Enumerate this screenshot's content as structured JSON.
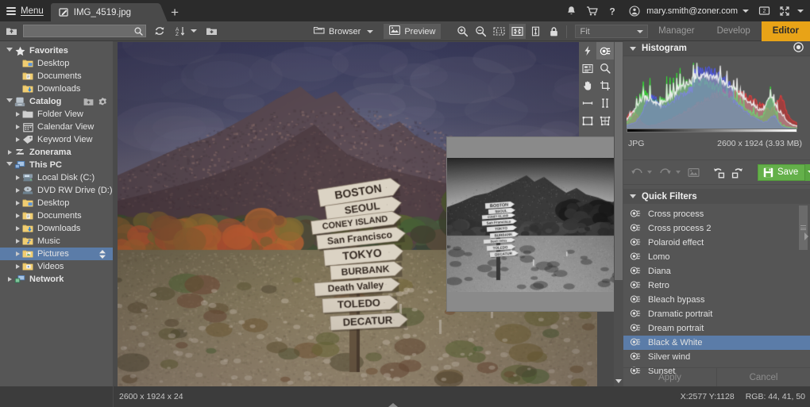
{
  "titlebar": {
    "menu_label": "Menu",
    "tab_title": "IMG_4519.jpg",
    "new_tab_label": "+",
    "account_email": "mary.smith@zoner.com",
    "icons": [
      "bell-icon",
      "cart-icon",
      "help-icon",
      "user-icon",
      "screen-icon",
      "fullscreen-icon"
    ]
  },
  "toolbar": {
    "search_value": "",
    "search_placeholder": "",
    "browser_label": "Browser",
    "preview_label": "Preview",
    "zoom_value": "Fit",
    "modes": [
      {
        "label": "Manager",
        "selected": false
      },
      {
        "label": "Develop",
        "selected": false
      },
      {
        "label": "Editor",
        "selected": true
      }
    ]
  },
  "sidebar": {
    "import_label": "Import",
    "items": [
      {
        "label": "Favorites",
        "level": 0,
        "icon": "star-icon",
        "arrow": "open",
        "group": true,
        "selected": false
      },
      {
        "label": "Desktop",
        "level": 1,
        "icon": "folder-desktop-icon",
        "arrow": "none",
        "group": false,
        "selected": false
      },
      {
        "label": "Documents",
        "level": 1,
        "icon": "folder-doc-icon",
        "arrow": "none",
        "group": false,
        "selected": false
      },
      {
        "label": "Downloads",
        "level": 1,
        "icon": "folder-dl-icon",
        "arrow": "none",
        "group": false,
        "selected": false
      },
      {
        "label": "Catalog",
        "level": 0,
        "icon": "catalog-icon",
        "arrow": "open",
        "group": true,
        "selected": false,
        "actions": [
          "add-folder-icon",
          "gear-icon"
        ]
      },
      {
        "label": "Folder View",
        "level": 1,
        "icon": "folder-icon",
        "arrow": "closed",
        "group": false,
        "selected": false
      },
      {
        "label": "Calendar View",
        "level": 1,
        "icon": "calendar-icon",
        "arrow": "closed",
        "group": false,
        "selected": false
      },
      {
        "label": "Keyword View",
        "level": 1,
        "icon": "tag-icon",
        "arrow": "closed",
        "group": false,
        "selected": false
      },
      {
        "label": "Zonerama",
        "level": 0,
        "icon": "zonerama-icon",
        "arrow": "closed",
        "group": true,
        "selected": false
      },
      {
        "label": "This PC",
        "level": 0,
        "icon": "pc-icon",
        "arrow": "open",
        "group": true,
        "selected": false
      },
      {
        "label": "Local Disk (C:)",
        "level": 1,
        "icon": "disk-icon",
        "arrow": "closed",
        "group": false,
        "selected": false
      },
      {
        "label": "DVD RW Drive (D:)",
        "level": 1,
        "icon": "dvd-icon",
        "arrow": "closed",
        "group": false,
        "selected": false
      },
      {
        "label": "Desktop",
        "level": 1,
        "icon": "folder-desktop-icon",
        "arrow": "closed",
        "group": false,
        "selected": false
      },
      {
        "label": "Documents",
        "level": 1,
        "icon": "folder-doc-icon",
        "arrow": "closed",
        "group": false,
        "selected": false
      },
      {
        "label": "Downloads",
        "level": 1,
        "icon": "folder-dl-icon",
        "arrow": "closed",
        "group": false,
        "selected": false
      },
      {
        "label": "Music",
        "level": 1,
        "icon": "folder-music-icon",
        "arrow": "closed",
        "group": false,
        "selected": false
      },
      {
        "label": "Pictures",
        "level": 1,
        "icon": "folder-pic-icon",
        "arrow": "closed",
        "group": false,
        "selected": true,
        "actions": [
          "updown-icon"
        ]
      },
      {
        "label": "Videos",
        "level": 1,
        "icon": "folder-video-icon",
        "arrow": "closed",
        "group": false,
        "selected": false
      },
      {
        "label": "Network",
        "level": 0,
        "icon": "network-icon",
        "arrow": "closed",
        "group": true,
        "selected": false
      }
    ]
  },
  "tools": [
    {
      "name": "effects-bolt-icon",
      "active": false
    },
    {
      "name": "filter-lens-icon",
      "active": true
    },
    {
      "name": "frame-icon",
      "active": false
    },
    {
      "name": "zoom-tool-icon",
      "active": false
    },
    {
      "name": "hand-tool-icon",
      "active": false
    },
    {
      "name": "crop-tool-icon",
      "active": false
    },
    {
      "name": "line-tool-icon",
      "active": false
    },
    {
      "name": "distance-tool-icon",
      "active": false
    },
    {
      "name": "rectangle-tool-icon",
      "active": false
    },
    {
      "name": "transform-tool-icon",
      "active": false
    },
    {
      "name": "gradient-tool-icon",
      "active": false
    },
    {
      "name": "redeye-tool-icon",
      "active": false
    }
  ],
  "histogram": {
    "title": "Histogram",
    "format": "JPG",
    "dimensions": "2600 x 1924 (3.93 MB)",
    "target_icon": "target-icon"
  },
  "actions": {
    "undo_icon": "undo-icon",
    "redo_icon": "redo-icon",
    "compare_icon": "compare-icon",
    "rotate_left_icon": "rotate-left-icon",
    "rotate_right_icon": "rotate-right-icon",
    "save_label": "Save",
    "share_icon": "share-icon"
  },
  "quick_filters": {
    "title": "Quick Filters",
    "apply_label": "Apply",
    "cancel_label": "Cancel",
    "items": [
      {
        "label": "Cross process",
        "selected": false
      },
      {
        "label": "Cross process 2",
        "selected": false
      },
      {
        "label": "Polaroid effect",
        "selected": false
      },
      {
        "label": "Lomo",
        "selected": false
      },
      {
        "label": "Diana",
        "selected": false
      },
      {
        "label": "Retro",
        "selected": false
      },
      {
        "label": "Bleach bypass",
        "selected": false
      },
      {
        "label": "Dramatic portrait",
        "selected": false
      },
      {
        "label": "Dream portrait",
        "selected": false
      },
      {
        "label": "Black & White",
        "selected": true
      },
      {
        "label": "Silver wind",
        "selected": false
      },
      {
        "label": "Sunset",
        "selected": false
      }
    ]
  },
  "status": {
    "image_info": "2600 x 1924 x 24",
    "coords": "X:2577 Y:1128",
    "rgb": "RGB: 44, 41, 50"
  },
  "colors": {
    "accent": "#e8a317",
    "selection": "#5b7ca8",
    "save_green": "#64b04a",
    "titlebar": "#2b2b2b",
    "toolbar": "#4a4a4a",
    "sidebar": "#565656",
    "panel": "#555555"
  },
  "photo": {
    "signpost_labels": [
      "BOSTON",
      "SEOUL",
      "CONEY ISLAND",
      "San Francisco",
      "TOKYO",
      "BURBANK",
      "Death Valley",
      "TOLEDO",
      "DECATUR"
    ]
  }
}
